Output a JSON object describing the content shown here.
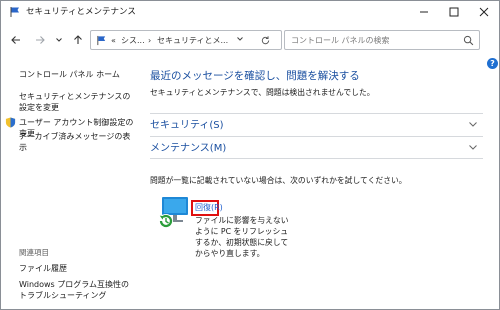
{
  "window": {
    "title": "セキュリティとメンテナンス"
  },
  "address": {
    "history_glyph": "«",
    "segment1": "シス...",
    "separator": "›",
    "segment2": "セキュリティとメ..."
  },
  "search": {
    "placeholder": "コントロール パネルの検索"
  },
  "sidebar": {
    "items": [
      {
        "label": "コントロール パネル ホーム"
      },
      {
        "label": "セキュリティとメンテナンスの設定を変更"
      },
      {
        "label": "ユーザー アカウント制御設定の変更"
      },
      {
        "label": "アーカイブ済みメッセージの表示"
      }
    ],
    "related_header": "関連項目",
    "related": [
      {
        "label": "ファイル履歴"
      },
      {
        "label": "Windows プログラム互換性のトラブルシューティング"
      }
    ]
  },
  "main": {
    "title": "最近のメッセージを確認し、問題を解決する",
    "subtitle": "セキュリティとメンテナンスで、問題は検出されませんでした。",
    "sections": [
      {
        "label": "セキュリティ(S)"
      },
      {
        "label": "メンテナンス(M)"
      }
    ],
    "hint": "問題が一覧に記載されていない場合は、次のいずれかを試してください。",
    "recovery": {
      "label": "回復(R)",
      "description": "ファイルに影響を与えないように PC をリフレッシュするか、初期状態に戻してからやり直します。"
    }
  },
  "colors": {
    "link_blue": "#1a4fa0",
    "highlight_red": "#e01010",
    "help_blue": "#1f6fd1"
  },
  "icons": {
    "app": "flag-icon",
    "help": "help-icon",
    "recovery": "pc-recovery-icon"
  }
}
